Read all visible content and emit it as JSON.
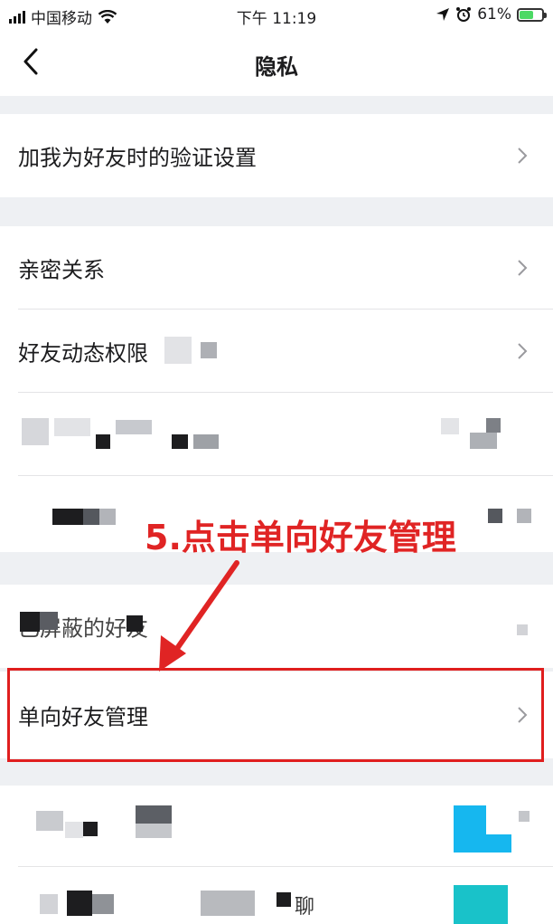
{
  "status_bar": {
    "carrier": "中国移动",
    "time": "下午 11:19",
    "battery": "61%",
    "battery_level": 0.61
  },
  "nav": {
    "title": "隐私"
  },
  "rows": {
    "verify": "加我为好友时的验证设置",
    "intimate": "亲密关系",
    "feed_permission": "好友动态权限",
    "blocked": "已屏蔽的好友",
    "one_way": "单向好友管理",
    "chat_partial": "聊"
  },
  "annotation": {
    "text": "5.点击单向好友管理",
    "color": "#e02424"
  },
  "colors": {
    "background": "#eef0f3",
    "row": "#ffffff",
    "highlight": "#e01e1e"
  }
}
